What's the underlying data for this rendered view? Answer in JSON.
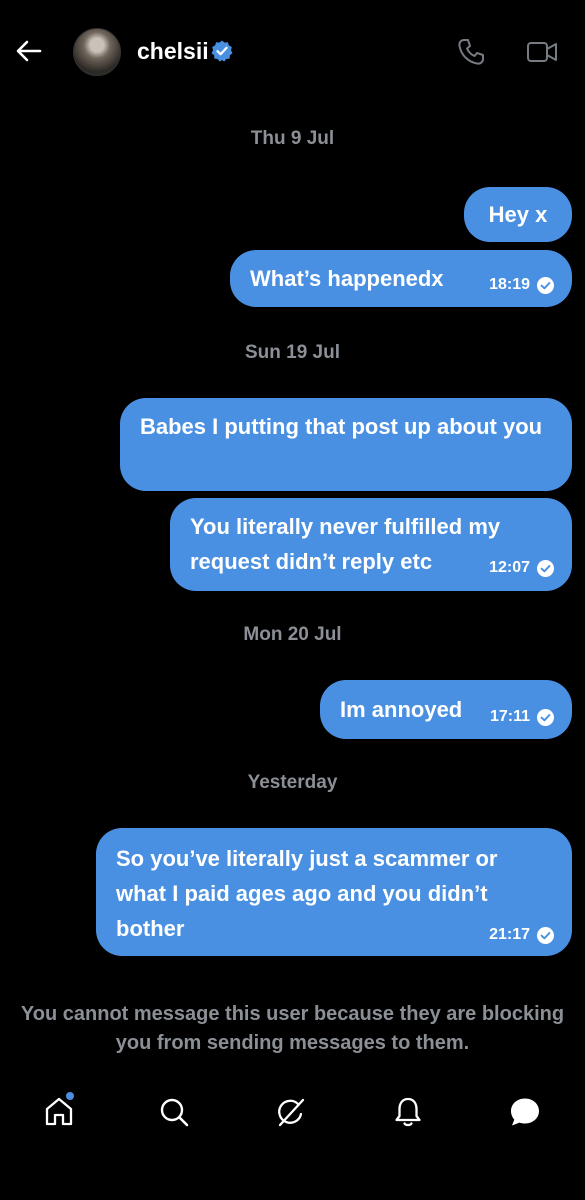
{
  "header": {
    "contact_name": "chelsii",
    "icons": {
      "back": "arrow-left-icon",
      "verified": "verified-badge-icon",
      "phone": "phone-icon",
      "video": "video-camera-icon"
    }
  },
  "messages": [
    {
      "date": "Thu 9 Jul",
      "bubbles": [
        {
          "text": "Hey x",
          "time": ""
        },
        {
          "text": "What’s happenedx",
          "time": "18:19"
        }
      ]
    },
    {
      "date": "Sun 19 Jul",
      "bubbles": [
        {
          "text": "Babes I putting that post up about you",
          "time": ""
        },
        {
          "text": "You literally never fulfilled my request didn’t reply etc",
          "time": "12:07"
        }
      ]
    },
    {
      "date": "Mon 20 Jul",
      "bubbles": [
        {
          "text": "Im annoyed",
          "time": "17:11"
        }
      ]
    },
    {
      "date": "Yesterday",
      "bubbles": [
        {
          "text": "So you’ve literally just a scammer or what I paid ages ago and you didn’t bother",
          "time": "21:17"
        }
      ]
    }
  ],
  "blocked_notice": "You cannot message this user because they are blocking you from sending messages to them.",
  "nav": {
    "items": [
      "home-icon",
      "search-icon",
      "grok-icon",
      "notifications-bell-icon",
      "messages-icon"
    ],
    "active": "messages-icon"
  },
  "colors": {
    "accent": "#4a90e2",
    "background": "#000000",
    "muted_text": "#8b8f96"
  }
}
